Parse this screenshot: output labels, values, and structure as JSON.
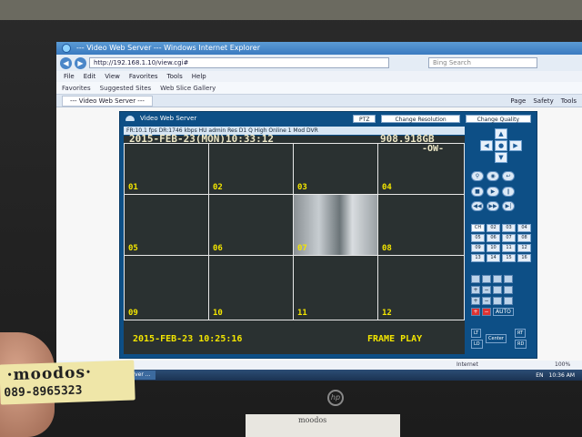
{
  "browser": {
    "title": "--- Video Web Server --- Windows Internet Explorer",
    "url": "http://192.168.1.10/view.cgi#",
    "search_placeholder": "Bing Search",
    "menu": [
      "File",
      "Edit",
      "View",
      "Favorites",
      "Tools",
      "Help"
    ],
    "favorites": [
      "Favorites",
      "Suggested Sites",
      "Web Slice Gallery"
    ],
    "tab_title": "--- Video Web Server ---",
    "tools": [
      "Page",
      "Safety",
      "Tools"
    ],
    "status_zone": "Internet",
    "zoom": "100%"
  },
  "dvr": {
    "header_title": "Video Web Server",
    "header_button_ptz": "PTZ",
    "change_resolution_label": "Change Resolution",
    "change_quality_label": "Change Quality",
    "status_line": "FR:10.1 fps  DR:1746 kbps  HU  admin  Res  D1  Q  High  Online  1 Mod  DVR",
    "osd_datetime": "2015-FEB-23(MON)10:33:12",
    "osd_disk": "908.918GB",
    "osd_mode": "-OW-",
    "osd_footer_datetime": "2015-FEB-23 10:25:16",
    "osd_footer_mode": "FRAME PLAY",
    "channels": [
      "01",
      "02",
      "03",
      "04",
      "05",
      "06",
      "07",
      "08",
      "09",
      "10",
      "11",
      "12"
    ],
    "channel_buttons": [
      "CH",
      "02",
      "03",
      "04",
      "05",
      "06",
      "07",
      "08",
      "09",
      "10",
      "11",
      "12",
      "13",
      "14",
      "15",
      "16"
    ],
    "auto_label": "AUTO",
    "ptz_labels": {
      "lt": "LT",
      "rt": "RT",
      "lo": "LO",
      "center": "Center",
      "rd": "RD"
    }
  },
  "taskbar": {
    "item": "--- Video Web Server ...",
    "lang": "EN",
    "time": "10:36 AM"
  },
  "monitor": {
    "brand": "hp"
  },
  "sticker": {
    "line1": "·moodos·",
    "line2": "089-8965323"
  },
  "stand_text": "moodos"
}
